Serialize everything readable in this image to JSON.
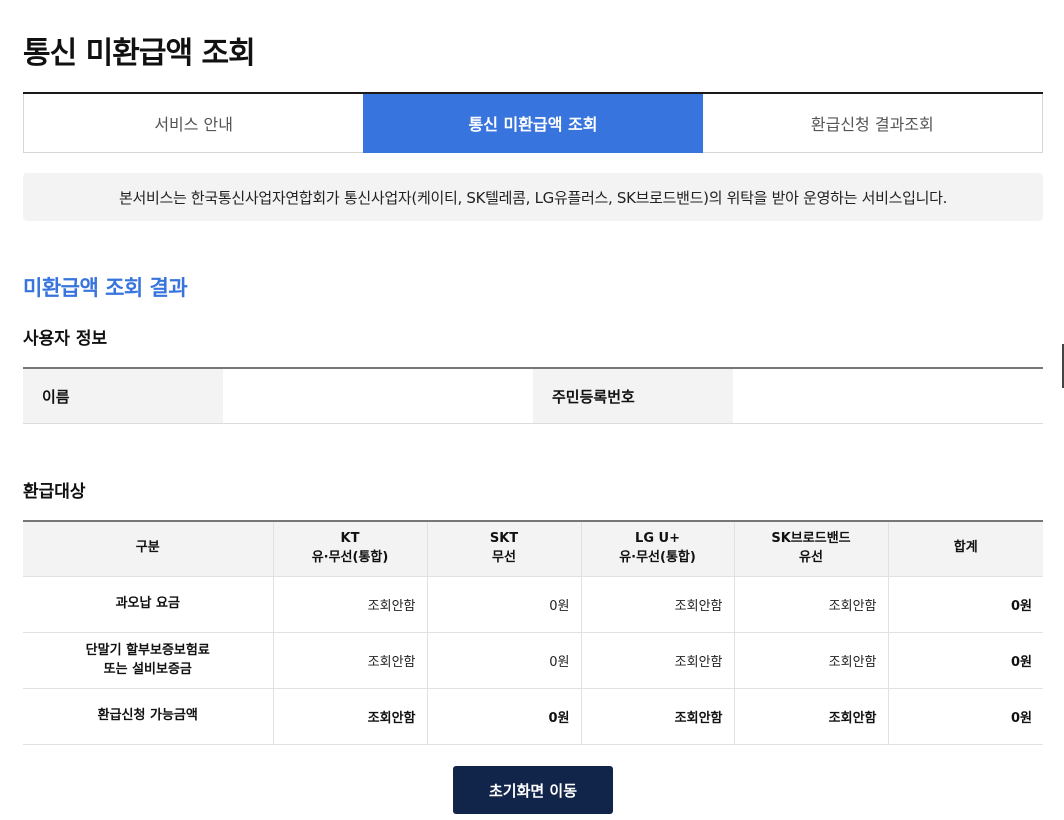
{
  "page_title": "통신 미환급액 조회",
  "tabs": [
    {
      "label": "서비스 안내"
    },
    {
      "label": "통신 미환급액 조회"
    },
    {
      "label": "환급신청 결과조회"
    }
  ],
  "notice": "본서비스는 한국통신사업자연합회가 통신사업자(케이티, SK텔레콤, LG유플러스, SK브로드밴드)의 위탁을 받아 운영하는 서비스입니다.",
  "result_title": "미환급액 조회 결과",
  "user_info": {
    "title": "사용자 정보",
    "name_label": "이름",
    "name_value": "",
    "rrn_label": "주민등록번호",
    "rrn_value": ""
  },
  "refund": {
    "title": "환급대상",
    "headers": [
      {
        "line1": "구분",
        "line2": ""
      },
      {
        "line1": "KT",
        "line2": "유·무선(통합)"
      },
      {
        "line1": "SKT",
        "line2": "무선"
      },
      {
        "line1": "LG U+",
        "line2": "유·무선(통합)"
      },
      {
        "line1": "SK브로드밴드",
        "line2": "유선"
      },
      {
        "line1": "합계",
        "line2": ""
      }
    ],
    "rows": [
      {
        "label_line1": "과오납 요금",
        "label_line2": "",
        "kt": "조회안함",
        "skt": "0원",
        "lgu": "조회안함",
        "skb": "조회안함",
        "total": "0원"
      },
      {
        "label_line1": "단말기 할부보증보험료",
        "label_line2": "또는 설비보증금",
        "kt": "조회안함",
        "skt": "0원",
        "lgu": "조회안함",
        "skb": "조회안함",
        "total": "0원"
      },
      {
        "label_line1": "환급신청 가능금액",
        "label_line2": "",
        "kt": "조회안함",
        "skt": "0원",
        "lgu": "조회안함",
        "skb": "조회안함",
        "total": "0원"
      }
    ]
  },
  "reset_button": "초기화면 이동",
  "colors": {
    "accent": "#3874dd",
    "button": "#11244a",
    "panel": "#f3f3f3"
  }
}
